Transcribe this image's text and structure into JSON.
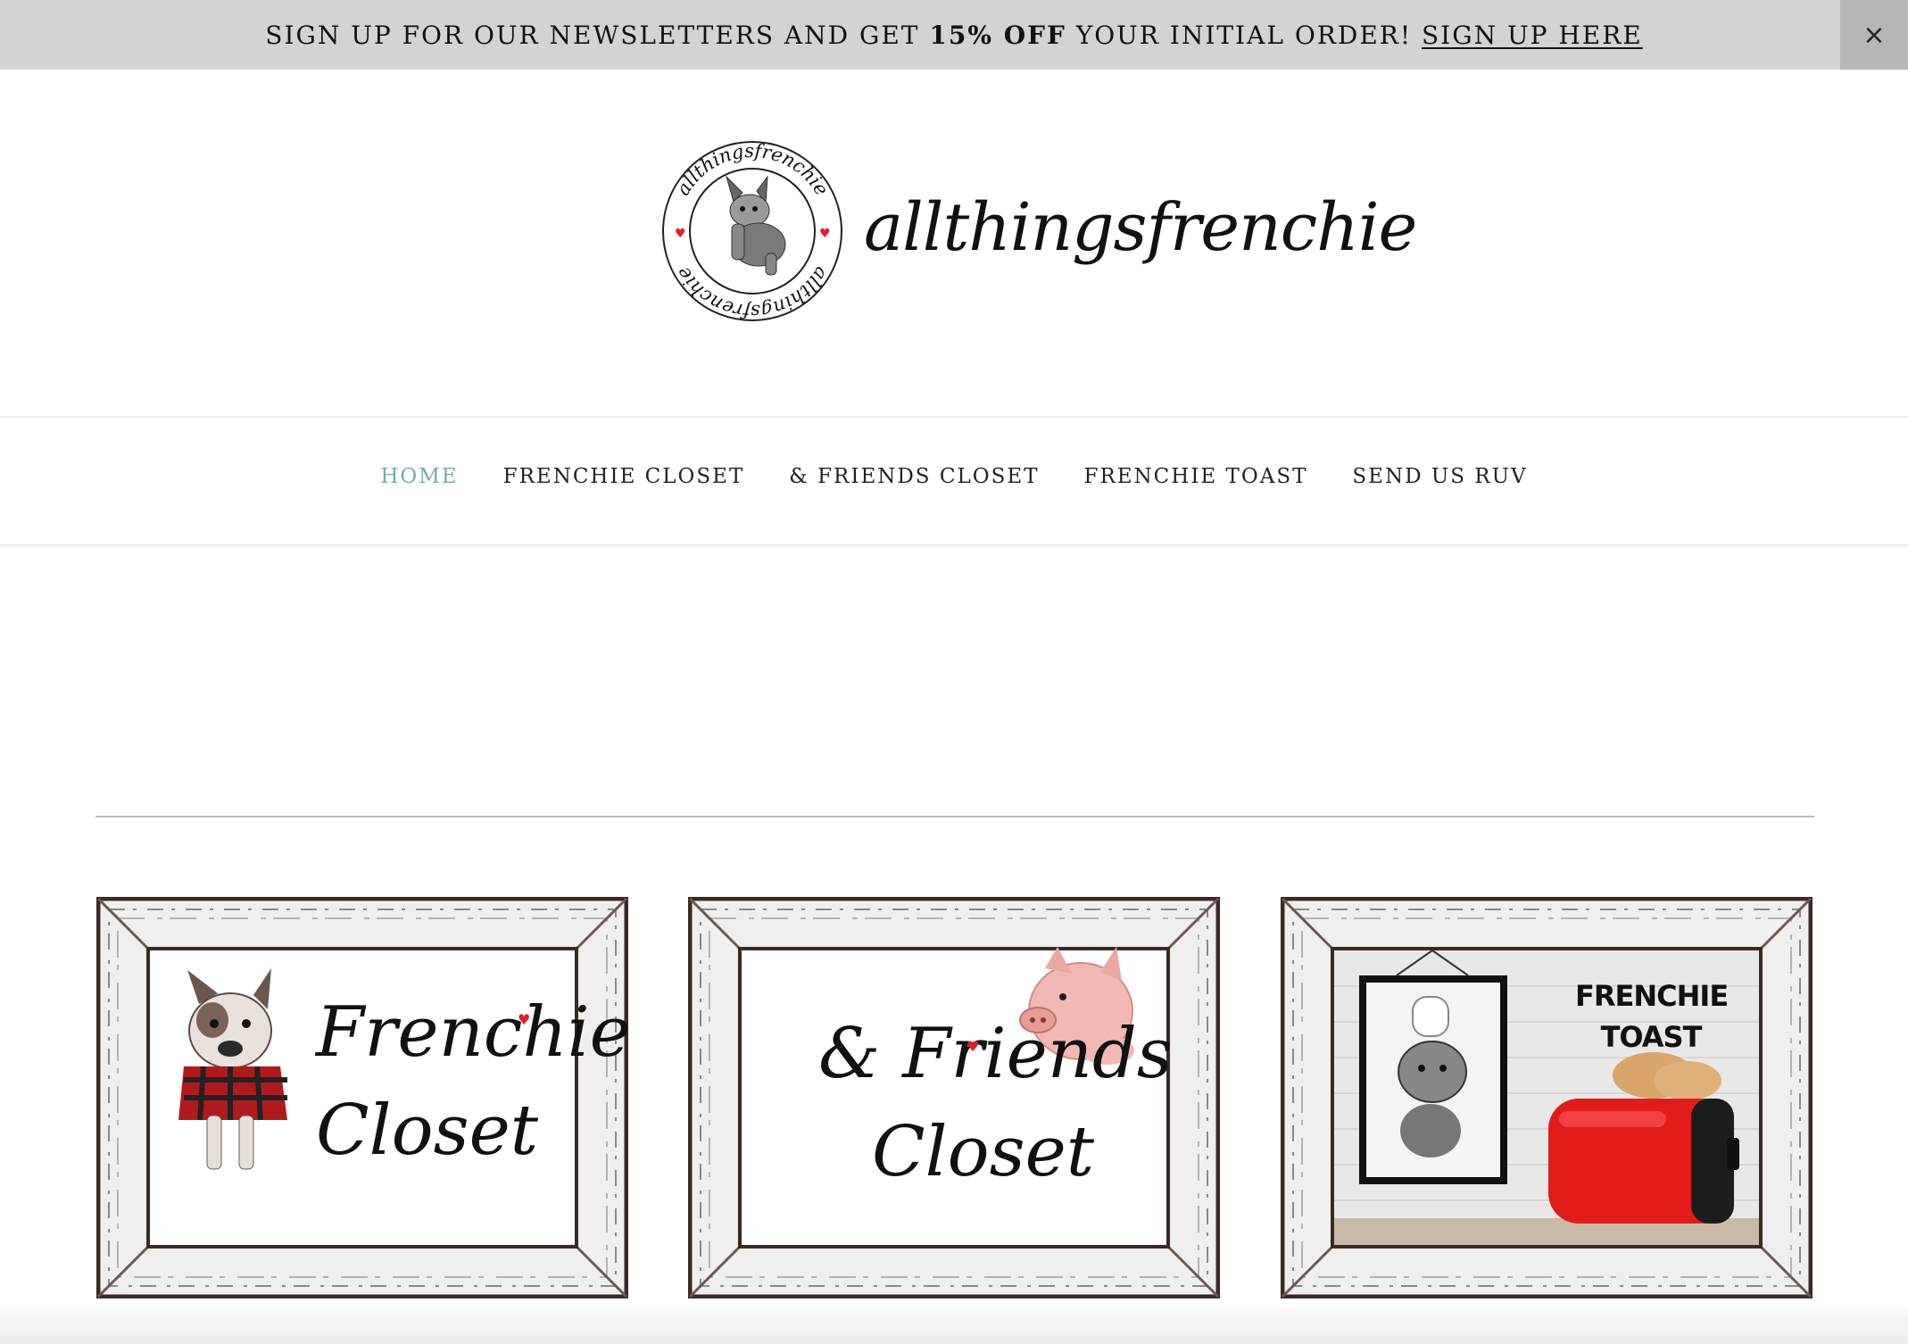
{
  "announcement": {
    "text_before": "SIGN UP FOR OUR NEWSLETTERS AND GET ",
    "text_bold": "15% OFF",
    "text_after": " YOUR INITIAL ORDER! ",
    "link_label": "SIGN UP HERE",
    "close_label": "×"
  },
  "brand": {
    "name": "allthingsfrenchie",
    "seal_text": "allthingsfrenchie",
    "heart_color": "#e0202a"
  },
  "nav": {
    "items": [
      {
        "label": "HOME",
        "active": true
      },
      {
        "label": "FRENCHIE CLOSET",
        "active": false
      },
      {
        "label": "& FRIENDS CLOSET",
        "active": false
      },
      {
        "label": "FRENCHIE TOAST",
        "active": false
      },
      {
        "label": "SEND US RUV",
        "active": false
      }
    ],
    "active_color": "#7aa9ad"
  },
  "tiles": [
    {
      "line1": "Frenchie",
      "line2": "Closet"
    },
    {
      "line1": "& Friends",
      "line2": "Closet"
    },
    {
      "line1": "FRENCHIE",
      "line2": "TOAST"
    }
  ]
}
